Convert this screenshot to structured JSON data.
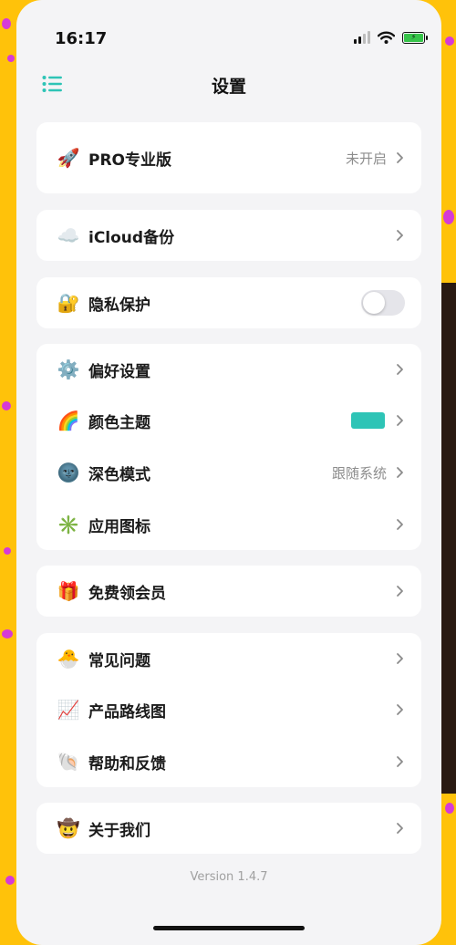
{
  "status_bar": {
    "time": "16:17",
    "icons": [
      "signal-icon",
      "wifi-icon",
      "battery-charging-icon"
    ],
    "battery_color": "#37c44a"
  },
  "nav": {
    "title": "设置",
    "menu_icon": "list-menu-icon",
    "accent_color": "#2ec4b6"
  },
  "pro": {
    "label": "PRO专业版",
    "value": "未开启",
    "icon": "rocket"
  },
  "icloud": {
    "label": "iCloud备份",
    "icon": "cloud"
  },
  "privacy": {
    "label": "隐私保护",
    "icon": "lock-with-key",
    "enabled": false
  },
  "preferences": {
    "items": [
      {
        "label": "偏好设置",
        "icon": "gear"
      },
      {
        "label": "颜色主题",
        "icon": "rainbow",
        "swatch_color": "#2ec4b6"
      },
      {
        "label": "深色模式",
        "icon": "new-moon-face",
        "value": "跟随系统"
      },
      {
        "label": "应用图标",
        "icon": "eight-spoked-asterisk"
      }
    ]
  },
  "membership": {
    "label": "免费领会员",
    "icon": "gift"
  },
  "support": {
    "items": [
      {
        "label": "常见问题",
        "icon": "hatching-chick"
      },
      {
        "label": "产品路线图",
        "icon": "chart-increasing"
      },
      {
        "label": "帮助和反馈",
        "icon": "spiral-shell"
      }
    ]
  },
  "about": {
    "label": "关于我们",
    "icon": "cowboy-hat-face"
  },
  "footer": {
    "version": "Version 1.4.7"
  }
}
